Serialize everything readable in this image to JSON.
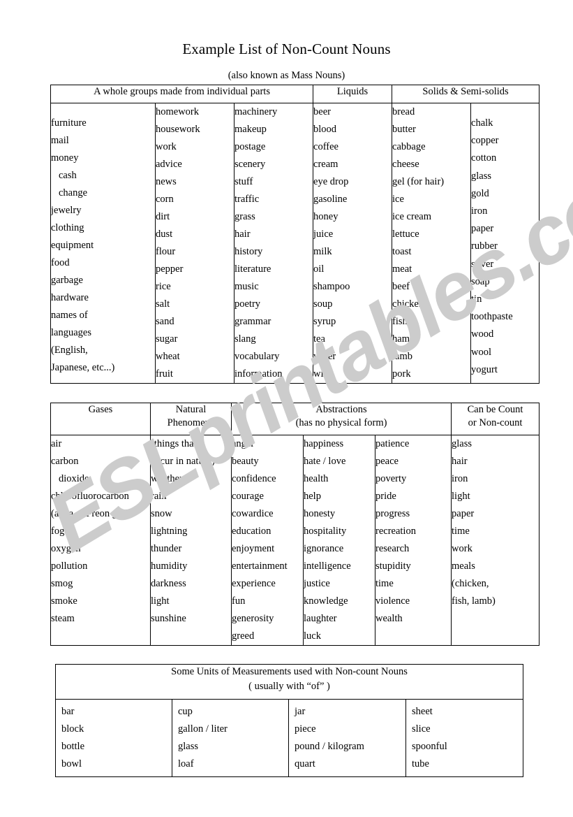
{
  "document": {
    "title": "Example List of Non-Count Nouns",
    "subtitle": "(also known as Mass Nouns)"
  },
  "watermark": {
    "text": "ESLprintables.com",
    "color": "#cccccc"
  },
  "table1": {
    "headers": [
      {
        "label": "A whole groups made from individual parts",
        "colspan": 3
      },
      {
        "label": "Liquids",
        "colspan": 1
      },
      {
        "label": "Solids & Semi-solids",
        "colspan": 2
      }
    ],
    "columns": [
      {
        "name": "whole-groups-col-1",
        "items": [
          "furniture",
          "mail",
          "money",
          "cash",
          "change",
          "jewelry",
          "clothing",
          "equipment",
          "food",
          "garbage",
          "hardware",
          "names of",
          "languages",
          "(English,",
          "Japanese, etc...)"
        ],
        "indented": [
          3,
          4
        ]
      },
      {
        "name": "whole-groups-col-2",
        "items": [
          "homework",
          "housework",
          "work",
          "advice",
          "news",
          "corn",
          "dirt",
          "dust",
          "flour",
          "pepper",
          "rice",
          "salt",
          "sand",
          "sugar",
          "wheat",
          "fruit"
        ],
        "indented": []
      },
      {
        "name": "whole-groups-col-3",
        "items": [
          "machinery",
          "makeup",
          "postage",
          "scenery",
          "stuff",
          "traffic",
          "grass",
          "hair",
          "history",
          "literature",
          "music",
          "poetry",
          "grammar",
          "slang",
          "vocabulary",
          "information"
        ],
        "indented": []
      },
      {
        "name": "liquids-col",
        "items": [
          "beer",
          "blood",
          "coffee",
          "cream",
          "eye drop",
          "gasoline",
          "honey",
          "juice",
          "milk",
          "oil",
          "shampoo",
          "soup",
          "syrup",
          "tea",
          "water",
          "wine"
        ],
        "indented": []
      },
      {
        "name": "solids-col-1",
        "items": [
          "bread",
          "butter",
          "cabbage",
          "cheese",
          "gel (for hair)",
          "ice",
          "ice cream",
          "lettuce",
          "toast",
          "meat",
          "beef",
          "chicken",
          "fish",
          "ham",
          "lamb",
          "pork"
        ],
        "indented": []
      },
      {
        "name": "solids-col-2",
        "items": [
          "chalk",
          "copper",
          "cotton",
          "glass",
          "gold",
          "iron",
          "paper",
          "rubber",
          "silver",
          "soap",
          "tin",
          "toothpaste",
          "wood",
          "wool",
          "yogurt"
        ],
        "indented": []
      }
    ]
  },
  "table2": {
    "headers": [
      {
        "line1": "Gases",
        "line2": "",
        "colspan": 1
      },
      {
        "line1": "Natural",
        "line2": "Phenomena",
        "colspan": 1
      },
      {
        "line1": "Abstractions",
        "line2": "(has no physical form)",
        "colspan": 3
      },
      {
        "line1": "Can be Count",
        "line2": "or Non-count",
        "colspan": 1
      }
    ],
    "columns": [
      {
        "name": "gases-col",
        "items": [
          "air",
          "carbon",
          "dioxide",
          "chlorofluorocarbon",
          "(a.k.a. – Freon gas)",
          "fog",
          "oxygen",
          "pollution",
          "smog",
          "smoke",
          "steam"
        ],
        "indented": [
          2
        ]
      },
      {
        "name": "natural-phenomena-col",
        "items": [
          "(things that",
          "occur in nature)",
          "weather",
          "rain",
          "snow",
          "lightning",
          "thunder",
          "humidity",
          "darkness",
          "light",
          "sunshine"
        ],
        "indented": []
      },
      {
        "name": "abstractions-col-1",
        "items": [
          "anger",
          "beauty",
          "confidence",
          "courage",
          "cowardice",
          "education",
          "enjoyment",
          "entertainment",
          "experience",
          "fun",
          "generosity",
          "greed"
        ],
        "indented": []
      },
      {
        "name": "abstractions-col-2",
        "items": [
          "happiness",
          "hate / love",
          "health",
          "help",
          "honesty",
          "hospitality",
          "ignorance",
          "intelligence",
          "justice",
          "knowledge",
          "laughter",
          "luck"
        ],
        "indented": []
      },
      {
        "name": "abstractions-col-3",
        "items": [
          "patience",
          "peace",
          "poverty",
          "pride",
          "progress",
          "recreation",
          "research",
          "stupidity",
          "time",
          "violence",
          "wealth"
        ],
        "indented": []
      },
      {
        "name": "count-or-noncount-col",
        "items": [
          "glass",
          "hair",
          "iron",
          "light",
          "paper",
          "time",
          "work",
          "meals",
          "(chicken,",
          "fish, lamb)"
        ],
        "indented": []
      }
    ]
  },
  "table3": {
    "header": {
      "line1": "Some Units of Measurements used with Non-count Nouns",
      "line2": "( usually with “of” )"
    },
    "columns": [
      {
        "name": "units-col-1",
        "items": [
          "bar",
          "block",
          "bottle",
          "bowl"
        ],
        "indented": []
      },
      {
        "name": "units-col-2",
        "items": [
          "cup",
          "gallon / liter",
          "glass",
          "loaf"
        ],
        "indented": []
      },
      {
        "name": "units-col-3",
        "items": [
          "jar",
          "piece",
          "pound / kilogram",
          "quart"
        ],
        "indented": []
      },
      {
        "name": "units-col-4",
        "items": [
          "sheet",
          "slice",
          "spoonful",
          "tube"
        ],
        "indented": []
      }
    ]
  }
}
